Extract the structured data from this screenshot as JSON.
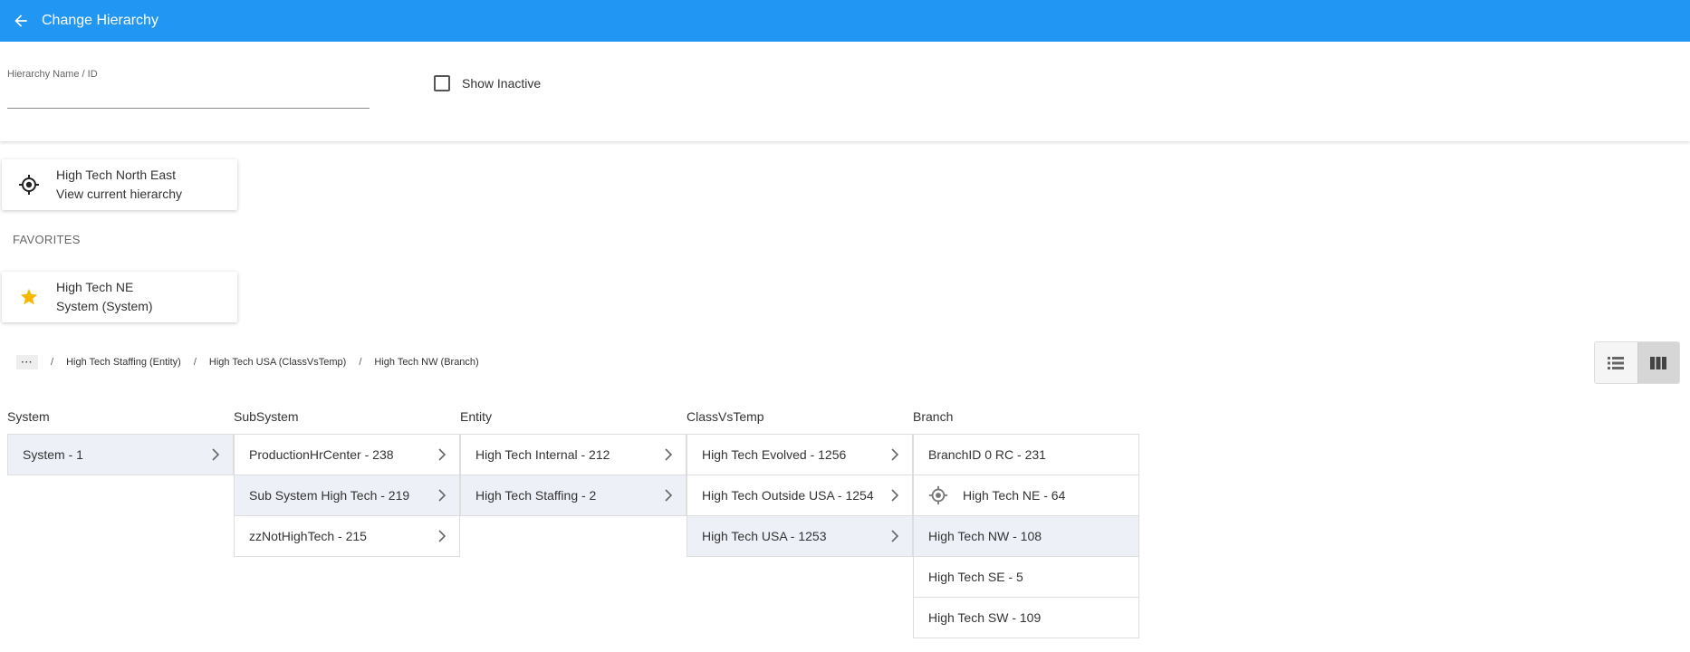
{
  "appbar": {
    "title": "Change Hierarchy"
  },
  "search": {
    "label": "Hierarchy Name / ID",
    "value": "",
    "show_inactive_label": "Show Inactive",
    "show_inactive_checked": false
  },
  "current": {
    "name": "High Tech North East",
    "subtitle": "View current hierarchy"
  },
  "favorites": {
    "label": "FAVORITES",
    "items": [
      {
        "name": "High Tech NE",
        "subtitle": "System (System)"
      }
    ]
  },
  "breadcrumb": {
    "more": "···",
    "items": [
      "High Tech Staffing (Entity)",
      "High Tech USA (ClassVsTemp)",
      "High Tech NW (Branch)"
    ]
  },
  "columns": [
    {
      "header": "System",
      "items": [
        {
          "label": "System - 1",
          "selected": true,
          "has_children": true
        }
      ]
    },
    {
      "header": "SubSystem",
      "items": [
        {
          "label": "ProductionHrCenter - 238",
          "selected": false,
          "has_children": true
        },
        {
          "label": "Sub System High Tech - 219",
          "selected": true,
          "has_children": true
        },
        {
          "label": "zzNotHighTech - 215",
          "selected": false,
          "has_children": true
        }
      ]
    },
    {
      "header": "Entity",
      "items": [
        {
          "label": "High Tech Internal - 212",
          "selected": false,
          "has_children": true
        },
        {
          "label": "High Tech Staffing - 2",
          "selected": true,
          "has_children": true
        }
      ]
    },
    {
      "header": "ClassVsTemp",
      "items": [
        {
          "label": "High Tech Evolved - 1256",
          "selected": false,
          "has_children": true
        },
        {
          "label": "High Tech Outside USA - 1254",
          "selected": false,
          "has_children": true
        },
        {
          "label": "High Tech USA - 1253",
          "selected": true,
          "has_children": true
        }
      ]
    },
    {
      "header": "Branch",
      "items": [
        {
          "label": "BranchID 0 RC - 231",
          "selected": false,
          "has_children": false
        },
        {
          "label": "High Tech NE - 64",
          "selected": false,
          "has_children": false,
          "current": true
        },
        {
          "label": "High Tech NW - 108",
          "selected": true,
          "has_children": false
        },
        {
          "label": "High Tech SE - 5",
          "selected": false,
          "has_children": false
        },
        {
          "label": "High Tech SW - 109",
          "selected": false,
          "has_children": false
        }
      ]
    }
  ],
  "colors": {
    "appbar": "#2196f3",
    "selected_row": "#eef0f8",
    "star": "#f5b800"
  },
  "view_toggle": {
    "options": [
      "list-view-icon",
      "column-view-icon"
    ],
    "active": "column-view-icon"
  }
}
